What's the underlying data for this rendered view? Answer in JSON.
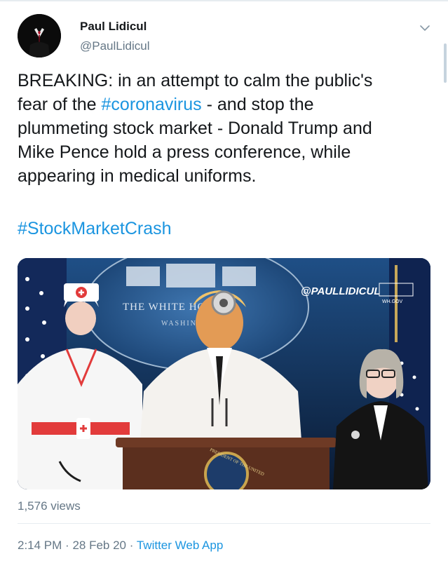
{
  "author": {
    "display_name": "Paul Lidicul",
    "handle": "@PaulLidicul"
  },
  "tweet": {
    "text_lines": [
      {
        "before": "BREAKING: in an attempt to calm the public's",
        "link": "",
        "after": ""
      },
      {
        "before": "fear of the ",
        "link": "#coronavirus",
        "after": " - and stop the"
      },
      {
        "before": "plummeting stock market - Donald Trump and",
        "link": "",
        "after": ""
      },
      {
        "before": "Mike Pence hold a press conference, while",
        "link": "",
        "after": ""
      },
      {
        "before": "appearing in medical uniforms.",
        "link": "",
        "after": ""
      }
    ],
    "hashtag": "#StockMarketCrash"
  },
  "media": {
    "watermark": "@PAULLIDICUL",
    "seal_text": "THE WHITE HOUSE",
    "seal_subtext": "WASHINGTON",
    "site_text": "WH.GOV",
    "podium_seal_text": "PRESIDENT OF THE UNITED"
  },
  "stats": {
    "views": "1,576 views"
  },
  "meta": {
    "time": "2:14 PM",
    "date": "28 Feb 20",
    "separator": "·",
    "source": "Twitter Web App"
  },
  "colors": {
    "link": "#1b95e0",
    "text": "#14171a",
    "secondary": "#657786",
    "divider": "#e6ecf0"
  },
  "icons": {
    "caret": "chevron-down-icon",
    "avatar": "tuxedo-avatar-icon"
  }
}
